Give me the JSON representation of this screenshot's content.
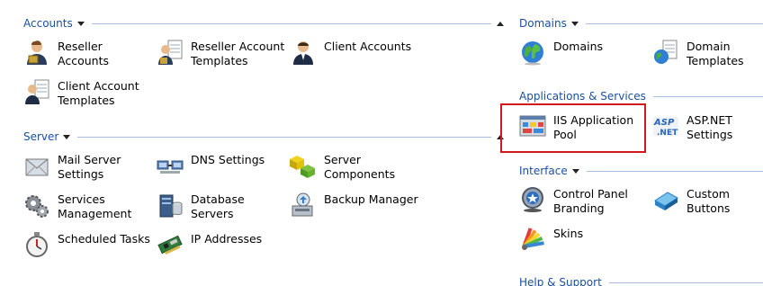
{
  "sections": {
    "accounts": {
      "title": "Accounts"
    },
    "server": {
      "title": "Server"
    },
    "domains": {
      "title": "Domains"
    },
    "apps": {
      "title": "Applications & Services"
    },
    "interface": {
      "title": "Interface"
    },
    "help": {
      "title": "Help & Support"
    }
  },
  "items": {
    "reseller_accounts": "Reseller\nAccounts",
    "reseller_account_templates": "Reseller Account\nTemplates",
    "client_accounts": "Client Accounts",
    "client_account_templates": "Client Account\nTemplates",
    "mail_server_settings": "Mail Server\nSettings",
    "dns_settings": "DNS Settings",
    "server_components": "Server\nComponents",
    "services_management": "Services\nManagement",
    "database_servers": "Database\nServers",
    "backup_manager": "Backup Manager",
    "scheduled_tasks": "Scheduled Tasks",
    "ip_addresses": "IP Addresses",
    "domains": "Domains",
    "domain_templates": "Domain\nTemplates",
    "iis_application_pool": "IIS Application\nPool",
    "aspnet_settings": "ASP.NET\nSettings",
    "control_panel_branding": "Control Panel\nBranding",
    "custom_buttons": "Custom Buttons",
    "skins": "Skins"
  },
  "icons": {
    "aspnet_text": "ASP\n.NET"
  },
  "colors": {
    "section_title": "#1a4f9e",
    "rule": "#a9bde0",
    "highlight": "#d11a1a"
  }
}
